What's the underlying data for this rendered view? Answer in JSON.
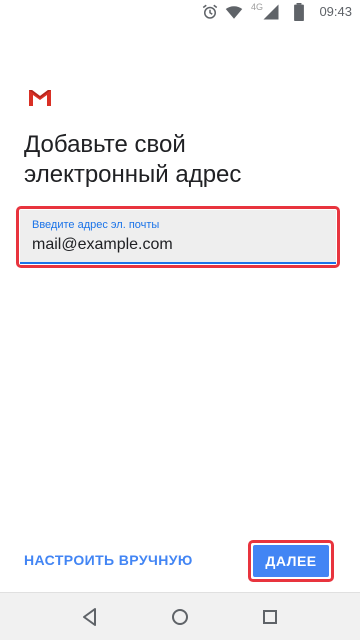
{
  "status_bar": {
    "time": "09:43",
    "network_label": "4G",
    "icons": [
      "alarm-icon",
      "wifi-icon",
      "signal-icon",
      "battery-icon"
    ]
  },
  "app": {
    "logo": "gmail-logo",
    "brand_color": "#d93025"
  },
  "page": {
    "title": "Добавьте свой электронный адрес"
  },
  "email_field": {
    "label": "Введите адрес эл. почты",
    "value": "mail@example.com"
  },
  "actions": {
    "manual_setup": "НАСТРОИТЬ ВРУЧНУЮ",
    "next": "ДАЛЕЕ"
  },
  "nav_bar": {
    "icons": [
      "back-icon",
      "home-icon",
      "recents-icon"
    ]
  },
  "colors": {
    "accent": "#4285f4",
    "highlight": "#e8343e",
    "field_bg": "#eeeeee"
  }
}
